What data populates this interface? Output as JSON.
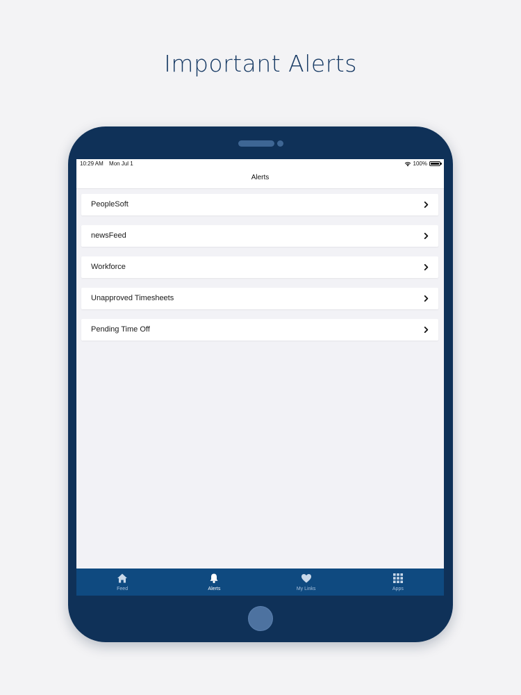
{
  "headline": "Important Alerts",
  "status_bar": {
    "time": "10:29 AM",
    "date": "Mon Jul 1",
    "battery": "100%"
  },
  "nav": {
    "title": "Alerts"
  },
  "alerts": [
    {
      "label": "PeopleSoft"
    },
    {
      "label": "newsFeed"
    },
    {
      "label": "Workforce"
    },
    {
      "label": "Unapproved Timesheets"
    },
    {
      "label": "Pending Time Off"
    }
  ],
  "tabs": [
    {
      "label": "Feed",
      "icon": "home-icon",
      "active": false
    },
    {
      "label": "Alerts",
      "icon": "bell-icon",
      "active": true
    },
    {
      "label": "My Links",
      "icon": "heart-icon",
      "active": false
    },
    {
      "label": "Apps",
      "icon": "grid-icon",
      "active": false
    }
  ],
  "colors": {
    "device": "#0f3158",
    "tab_bar": "#0f4a80",
    "headline": "#173a64",
    "background": "#f3f3f5"
  }
}
